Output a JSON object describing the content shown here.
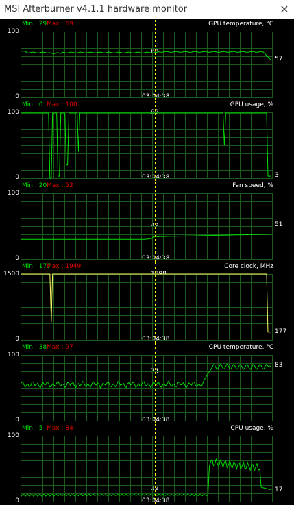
{
  "window": {
    "title": "MSI Afterburner v4.1.1 hardware monitor",
    "close_icon": "close-icon"
  },
  "colors": {
    "grid": "#1a5a1a",
    "gpu_line": "#00e000",
    "clock_line": "#ffff66",
    "cursor": "#ffff00",
    "min": "#00e000",
    "max": "#e00000"
  },
  "cursor": {
    "time": "03:04:38"
  },
  "graphs": [
    {
      "name": "GPU temperature, °C",
      "min_label": "Min : 29",
      "max_label": "Max : 69",
      "y_top": "100",
      "y_bottom": "0",
      "ymax": 100,
      "cursor_value": "68",
      "current_value": "57",
      "time": "03:04:38"
    },
    {
      "name": "GPU usage, %",
      "min_label": "Min : 0",
      "max_label": "Max : 100",
      "y_top": "100",
      "y_bottom": "0",
      "ymax": 100,
      "cursor_value": "99",
      "current_value": "3",
      "time": "03:04:38"
    },
    {
      "name": "Fan speed, %",
      "min_label": "Min : 20",
      "max_label": "Max : 52",
      "y_top": "100",
      "y_bottom": "0",
      "ymax": 100,
      "cursor_value": "49",
      "current_value": "51",
      "time": "03:04:38"
    },
    {
      "name": "Core clock, MHz",
      "min_label": "Min : 177",
      "max_label": "Max : 1949",
      "y_top": "1500",
      "y_bottom": "0",
      "ymax": 1500,
      "cursor_value": "1898",
      "current_value": "177",
      "time": "03:04:38"
    },
    {
      "name": "CPU temperature, °C",
      "min_label": "Min : 38",
      "max_label": "Max : 97",
      "y_top": "100",
      "y_bottom": "0",
      "ymax": 100,
      "cursor_value": "74",
      "current_value": "83",
      "time": "03:04:38"
    },
    {
      "name": "CPU usage, %",
      "min_label": "Min : 5",
      "max_label": "Max : 84",
      "y_top": "100",
      "y_bottom": "0",
      "ymax": 100,
      "cursor_value": "19",
      "current_value": "17",
      "time": "03:04:38"
    }
  ]
}
